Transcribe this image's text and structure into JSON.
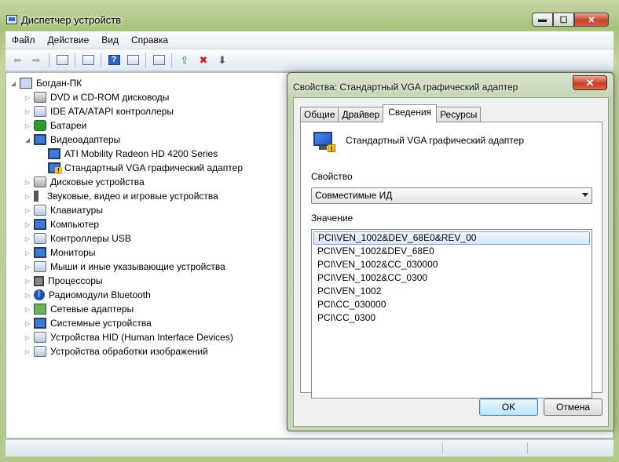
{
  "window": {
    "title": "Диспетчер устройств",
    "minimize": "▬",
    "maximize": "☐",
    "close": "✕"
  },
  "menu": [
    "Файл",
    "Действие",
    "Вид",
    "Справка"
  ],
  "tree": {
    "root": "Богдан-ПК",
    "items": [
      {
        "label": "DVD и CD-ROM дисководы",
        "icon": "disc-drive-icon"
      },
      {
        "label": "IDE ATA/ATAPI контроллеры",
        "icon": "ide-controller-icon"
      },
      {
        "label": "Батареи",
        "icon": "battery-icon"
      },
      {
        "label": "Видеоадаптеры",
        "icon": "display-adapter-icon",
        "expanded": true,
        "children": [
          {
            "label": "ATI Mobility Radeon HD 4200 Series",
            "icon": "display-adapter-icon"
          },
          {
            "label": "Стандартный VGA графический адаптер",
            "icon": "display-adapter-warning-icon"
          }
        ]
      },
      {
        "label": "Дисковые устройства",
        "icon": "disk-drive-icon"
      },
      {
        "label": "Звуковые, видео и игровые устройства",
        "icon": "sound-icon"
      },
      {
        "label": "Клавиатуры",
        "icon": "keyboard-icon"
      },
      {
        "label": "Компьютер",
        "icon": "computer-icon"
      },
      {
        "label": "Контроллеры USB",
        "icon": "usb-icon"
      },
      {
        "label": "Мониторы",
        "icon": "monitor-icon"
      },
      {
        "label": "Мыши и иные указывающие устройства",
        "icon": "mouse-icon"
      },
      {
        "label": "Процессоры",
        "icon": "processor-icon"
      },
      {
        "label": "Радиомодули Bluetooth",
        "icon": "bluetooth-icon"
      },
      {
        "label": "Сетевые адаптеры",
        "icon": "network-adapter-icon"
      },
      {
        "label": "Системные устройства",
        "icon": "system-device-icon"
      },
      {
        "label": "Устройства HID (Human Interface Devices)",
        "icon": "hid-icon"
      },
      {
        "label": "Устройства обработки изображений",
        "icon": "imaging-icon"
      }
    ]
  },
  "dialog": {
    "title": "Свойства: Стандартный VGA графический адаптер",
    "close": "✕",
    "tabs": [
      "Общие",
      "Драйвер",
      "Сведения",
      "Ресурсы"
    ],
    "active_tab": "Сведения",
    "device_name": "Стандартный VGA графический адаптер",
    "property_label": "Свойство",
    "property_value": "Совместимые ИД",
    "value_label": "Значение",
    "values": [
      "PCI\\VEN_1002&DEV_68E0&REV_00",
      "PCI\\VEN_1002&DEV_68E0",
      "PCI\\VEN_1002&CC_030000",
      "PCI\\VEN_1002&CC_0300",
      "PCI\\VEN_1002",
      "PCI\\CC_030000",
      "PCI\\CC_0300"
    ],
    "ok": "OK",
    "cancel": "Отмена"
  }
}
